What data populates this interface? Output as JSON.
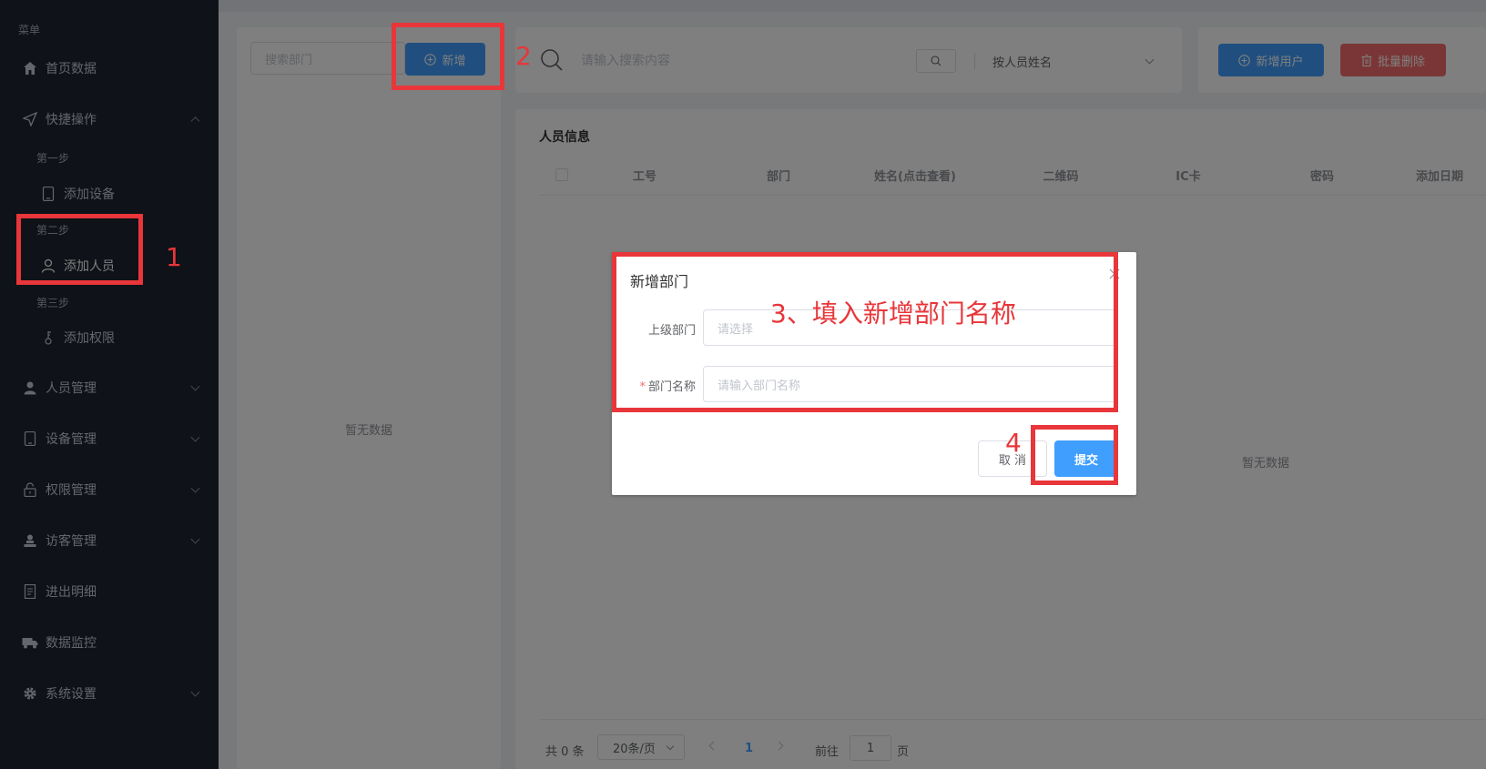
{
  "sidebar": {
    "menu_title": "菜单",
    "items": [
      {
        "label": "首页数据",
        "icon": "home-icon"
      },
      {
        "label": "快捷操作",
        "icon": "send-icon"
      },
      {
        "label": "人员管理",
        "icon": "user-icon"
      },
      {
        "label": "设备管理",
        "icon": "tablet-icon"
      },
      {
        "label": "权限管理",
        "icon": "lock-icon"
      },
      {
        "label": "访客管理",
        "icon": "visitor-icon"
      },
      {
        "label": "进出明细",
        "icon": "document-icon"
      },
      {
        "label": "数据监控",
        "icon": "truck-icon"
      },
      {
        "label": "系统设置",
        "icon": "gear-icon"
      }
    ],
    "steps": [
      {
        "step": "第一步",
        "label": "添加设备",
        "icon": "tablet-icon"
      },
      {
        "step": "第二步",
        "label": "添加人员",
        "icon": "user-icon"
      },
      {
        "step": "第三步",
        "label": "添加权限",
        "icon": "key-icon"
      }
    ]
  },
  "dept_panel": {
    "search_placeholder": "搜索部门",
    "add_button": "新增",
    "empty_text": "暂无数据"
  },
  "search_bar": {
    "placeholder": "请输入搜索内容",
    "select_value": "按人员姓名"
  },
  "toolbar": {
    "add_user": "新增用户",
    "batch_delete": "批量删除"
  },
  "table": {
    "title": "人员信息",
    "columns": [
      "工号",
      "部门",
      "姓名(点击查看)",
      "二维码",
      "IC卡",
      "密码",
      "添加日期"
    ],
    "empty_text": "暂无数据"
  },
  "pagination": {
    "total": "共 0 条",
    "page_size": "20条/页",
    "current_page": "1",
    "goto_label": "前往",
    "goto_value": "1",
    "page_unit": "页"
  },
  "dialog": {
    "title": "新增部门",
    "parent_label": "上级部门",
    "parent_placeholder": "请选择",
    "name_label": "部门名称",
    "name_required": "*",
    "name_placeholder": "请输入部门名称",
    "cancel": "取 消",
    "submit": "提交"
  },
  "annotations": {
    "n1": "1",
    "n2": "2",
    "n3_text": "3、填入新增部门名称",
    "n4": "4"
  },
  "colors": {
    "sidebar_bg": "#1f2430",
    "primary": "#409eff",
    "danger": "#f56c6c",
    "annotation": "#e8363a"
  }
}
